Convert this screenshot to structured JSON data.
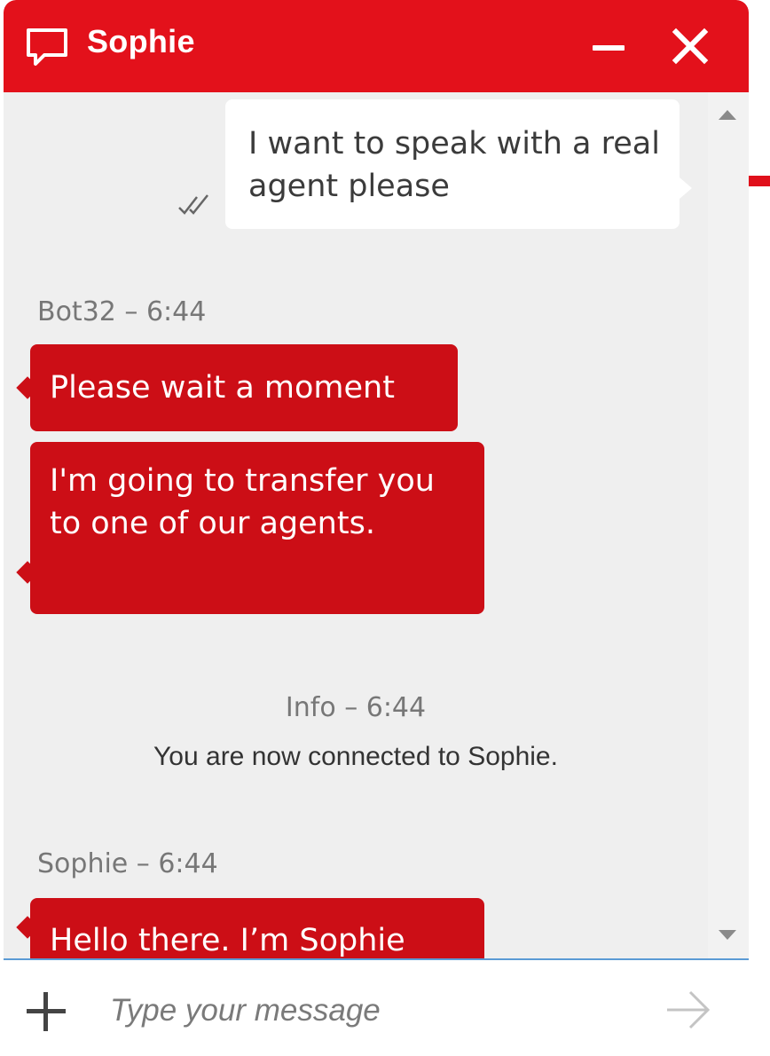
{
  "header": {
    "title": "Sophie",
    "chat_icon": "chat-bubble-icon",
    "minimize_icon": "minimize-icon",
    "close_icon": "close-icon",
    "accent_color": "#e3111b"
  },
  "messages": {
    "user_message": "I want to speak with a real agent please",
    "read_icon": "double-check-icon",
    "bot_meta": "Bot32 – 6:44",
    "bot_messages": [
      "Please wait a moment",
      "I'm going to transfer you to one of our agents."
    ],
    "info_meta": "Info – 6:44",
    "info_text": "You are now connected to Sophie.",
    "agent_meta": "Sophie – 6:44",
    "agent_message": "Hello there. I’m Sophie",
    "bubble_color": "#cc0e16"
  },
  "composer": {
    "placeholder": "Type your message",
    "add_icon": "plus-icon",
    "send_icon": "arrow-right-icon"
  }
}
